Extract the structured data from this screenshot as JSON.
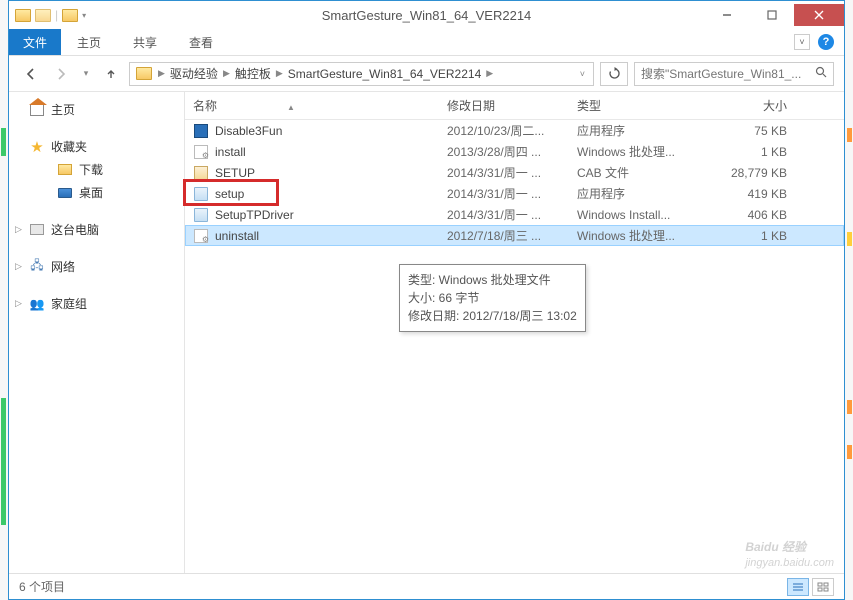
{
  "titlebar": {
    "title": "SmartGesture_Win81_64_VER2214"
  },
  "ribbon": {
    "file": "文件",
    "home": "主页",
    "share": "共享",
    "view": "查看"
  },
  "breadcrumbs": [
    "驱动经验",
    "触控板",
    "SmartGesture_Win81_64_VER2214"
  ],
  "search": {
    "placeholder": "搜索\"SmartGesture_Win81_..."
  },
  "sidebar": {
    "home": "主页",
    "favorites": "收藏夹",
    "downloads": "下载",
    "desktop": "桌面",
    "thispc": "这台电脑",
    "network": "网络",
    "homegroup": "家庭组"
  },
  "columns": {
    "name": "名称",
    "date": "修改日期",
    "type": "类型",
    "size": "大小"
  },
  "files": [
    {
      "name": "Disable3Fun",
      "date": "2012/10/23/周二...",
      "type": "应用程序",
      "size": "75 KB",
      "ico": "blue"
    },
    {
      "name": "install",
      "date": "2013/3/28/周四 ...",
      "type": "Windows 批处理...",
      "size": "1 KB",
      "ico": "bat"
    },
    {
      "name": "SETUP",
      "date": "2014/3/31/周一 ...",
      "type": "CAB 文件",
      "size": "28,779 KB",
      "ico": "cab"
    },
    {
      "name": "setup",
      "date": "2014/3/31/周一 ...",
      "type": "应用程序",
      "size": "419 KB",
      "ico": "exe"
    },
    {
      "name": "SetupTPDriver",
      "date": "2014/3/31/周一 ...",
      "type": "Windows Install...",
      "size": "406 KB",
      "ico": "exe"
    },
    {
      "name": "uninstall",
      "date": "2012/7/18/周三 ...",
      "type": "Windows 批处理...",
      "size": "1 KB",
      "ico": "bat"
    }
  ],
  "tooltip": {
    "line1": "类型: Windows 批处理文件",
    "line2": "大小: 66 字节",
    "line3": "修改日期: 2012/7/18/周三 13:02"
  },
  "statusbar": {
    "count": "6 个项目"
  },
  "watermark": {
    "main": "Baidu 经验",
    "sub": "jingyan.baidu.com"
  }
}
